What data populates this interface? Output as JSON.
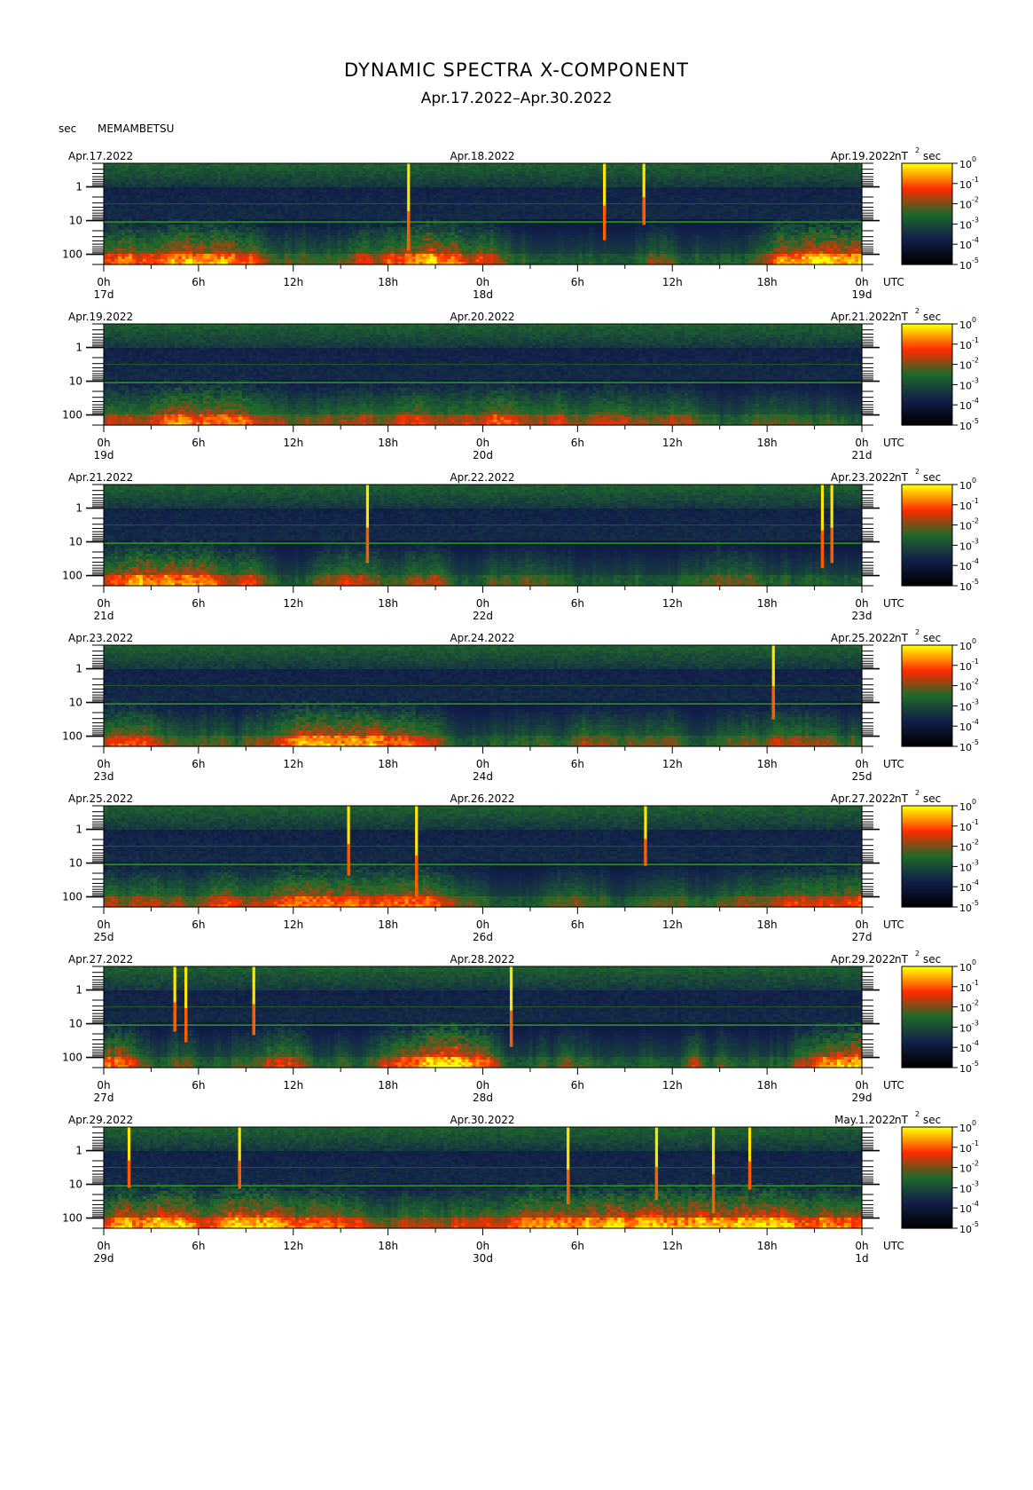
{
  "figure": {
    "title": "DYNAMIC SPECTRA X-COMPONENT",
    "subtitle": "Apr.17.2022–Apr.30.2022",
    "y_unit": "sec",
    "station": "MEMAMBETSU",
    "time_zone": "UTC",
    "colorbar_unit": "nT",
    "colorbar_unit_exp": "2",
    "colorbar_unit_suffix": "sec",
    "colorbar_base": "10",
    "colorbar_exps": [
      "0",
      "-1",
      "-2",
      "-3",
      "-4",
      "-5"
    ],
    "y_ticks": [
      "1",
      "10",
      "100"
    ],
    "x_tick_labels": [
      "0h",
      "6h",
      "12h",
      "18h",
      "0h",
      "6h",
      "12h",
      "18h",
      "0h"
    ]
  },
  "colors": {
    "background": "#ffffff",
    "colormap": [
      "#000000",
      "#12204a",
      "#1f6a2a",
      "#ff2a00",
      "#ffff00"
    ]
  },
  "chart_data": {
    "type": "heatmap",
    "title": "DYNAMIC SPECTRA X-COMPONENT",
    "xlabel": "UTC",
    "ylabel": "sec",
    "y_scale": "log",
    "ylim_sec": [
      0.2,
      200
    ],
    "color_scale": "log",
    "color_range": [
      1e-05,
      1
    ],
    "panels": [
      {
        "start": "Apr.17.2022",
        "mid": "Apr.18.2022",
        "end": "Apr.19.2022",
        "day_labels": [
          "17d",
          "18d",
          "19d"
        ],
        "spikes_h": [
          19.3,
          31.7,
          34.2
        ],
        "activity": 0.55
      },
      {
        "start": "Apr.19.2022",
        "mid": "Apr.20.2022",
        "end": "Apr.21.2022",
        "day_labels": [
          "19d",
          "20d",
          "21d"
        ],
        "spikes_h": [],
        "activity": 0.45
      },
      {
        "start": "Apr.21.2022",
        "mid": "Apr.22.2022",
        "end": "Apr.23.2022",
        "day_labels": [
          "21d",
          "22d",
          "23d"
        ],
        "spikes_h": [
          16.7,
          45.5,
          46.1
        ],
        "activity": 0.5
      },
      {
        "start": "Apr.23.2022",
        "mid": "Apr.24.2022",
        "end": "Apr.25.2022",
        "day_labels": [
          "23d",
          "24d",
          "25d"
        ],
        "spikes_h": [
          42.4
        ],
        "activity": 0.5
      },
      {
        "start": "Apr.25.2022",
        "mid": "Apr.26.2022",
        "end": "Apr.27.2022",
        "day_labels": [
          "25d",
          "26d",
          "27d"
        ],
        "spikes_h": [
          15.5,
          19.8,
          34.3
        ],
        "activity": 0.42
      },
      {
        "start": "Apr.27.2022",
        "mid": "Apr.28.2022",
        "end": "Apr.29.2022",
        "day_labels": [
          "27d",
          "28d",
          "29d"
        ],
        "spikes_h": [
          4.5,
          5.2,
          9.5,
          25.8
        ],
        "activity": 0.65
      },
      {
        "start": "Apr.29.2022",
        "mid": "Apr.30.2022",
        "end": "May.1.2022",
        "day_labels": [
          "29d",
          "30d",
          "1d"
        ],
        "spikes_h": [
          1.6,
          8.6,
          29.4,
          35.0,
          38.6,
          40.9
        ],
        "activity": 0.55
      }
    ]
  }
}
